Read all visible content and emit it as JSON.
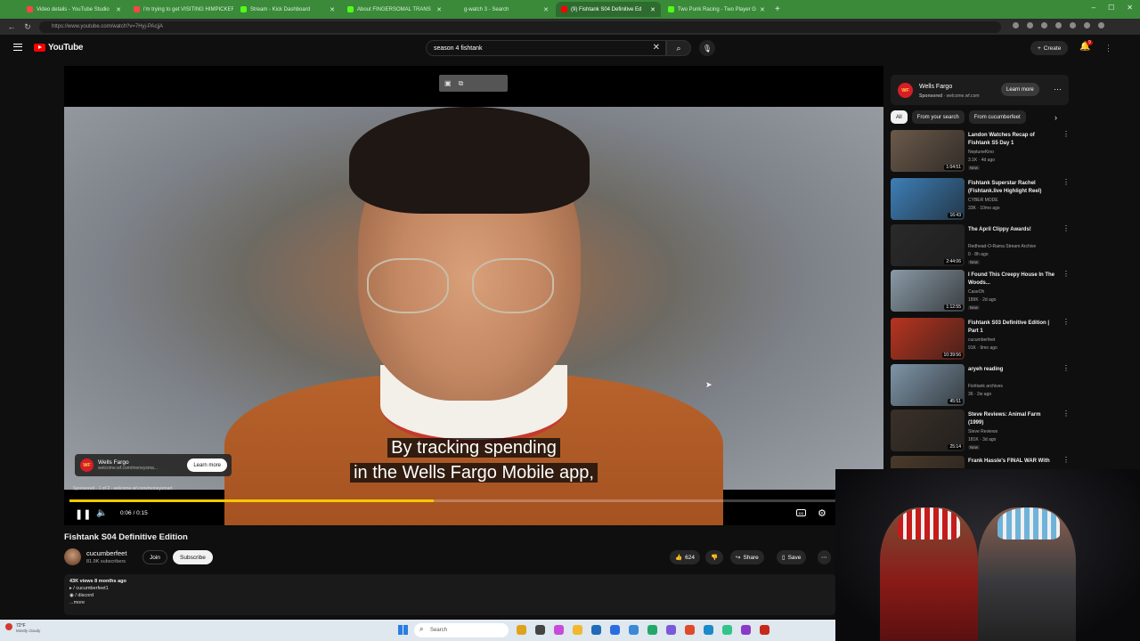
{
  "browser": {
    "tabs": [
      {
        "title": "Video details - YouTube Studio",
        "active": false,
        "icon_color": "#ff4444"
      },
      {
        "title": "i'm trying to get VISITING HIMPICKERS",
        "active": false,
        "icon_color": "#ff4444"
      },
      {
        "title": "Stream - Kick Dashboard",
        "active": false,
        "icon_color": "#53fc18"
      },
      {
        "title": "About FINGERSOMAL TRANS",
        "active": false,
        "icon_color": "#53fc18"
      },
      {
        "title": "g-watch 3 - Search",
        "active": false,
        "icon_color": "#3a8a3a"
      },
      {
        "title": "(9) Fishtank S04 Definitive Ed",
        "active": true,
        "icon_color": "#ff0000"
      },
      {
        "title": "Two Punk Racing - Two Player G",
        "active": false,
        "icon_color": "#53fc18"
      }
    ],
    "new_tab": "+",
    "url": "https://www.youtube.com/watch?v=7Hyj-PAcjjA"
  },
  "header": {
    "logo_text": "YouTube",
    "search_value": "season 4 fishtank",
    "clear_icon": "✕",
    "search_icon": "⌕",
    "mic_icon": "🎙",
    "create_label": "Create",
    "notif_count": "9"
  },
  "player": {
    "subtitle_line1": "By tracking spending",
    "subtitle_line2": "in the Wells Fargo Mobile app,",
    "ad_title": "Wells Fargo",
    "ad_url": "welcome.wf.com/moneysma...",
    "ad_learn": "Learn more",
    "sponsored_line": "Sponsored · 1 of 2 · welcome.wf.com/moneysmart",
    "time": "0:06 / 0:15",
    "progress": 0.45,
    "progress_color": "#f6c800",
    "cc_label": "CC",
    "badge_text": "WF"
  },
  "video": {
    "title": "Fishtank S04 Definitive Edition",
    "channel": "cucumberfeet",
    "subscribers": "81.9K subscribers",
    "join": "Join",
    "subscribe": "Subscribe",
    "likes": "624",
    "share": "Share",
    "save": "Save"
  },
  "description": {
    "meta": "43K views  8 months ago",
    "line1": "/ cucumberfeet1",
    "line2": "/ discord",
    "more": "...more"
  },
  "sidebar": {
    "ad_title": "Wells Fargo",
    "ad_sponsored": "Sponsored",
    "ad_url": "welcome.wf.com",
    "ad_learn": "Learn more",
    "chips": [
      "All",
      "From your search",
      "From cucumberfeet"
    ],
    "recs": [
      {
        "title": "Landon Watches Recap of Fishtank S5 Day 1",
        "channel": "NeptuneKino",
        "meta": "3.1K · 4d ago",
        "badge": "New",
        "duration": "1:04:51",
        "thumb": "#6b5a4a"
      },
      {
        "title": "Fishtank Superstar Rachel (Fishtank.live Highlight Reel)",
        "channel": "CYBER MODE",
        "meta": "33K · 10mo ago",
        "badge": "",
        "duration": "16:43",
        "thumb": "#3d7fb8"
      },
      {
        "title": "The April Clippy Awards!",
        "channel": "Redhead-O-Rama Stream Archive",
        "meta": "0 · 8h ago",
        "badge": "New",
        "duration": "2:44:06",
        "thumb": "#2a2a2a"
      },
      {
        "title": "I Found This Creepy House In The Woods...",
        "channel": "CaseOh",
        "meta": "189K · 2d ago",
        "badge": "New",
        "duration": "1:12:55",
        "thumb": "#8a9aa6"
      },
      {
        "title": "Fishtank S03 Definitive Edition | Part 1",
        "channel": "cucumberfeet",
        "meta": "91K · 9mo ago",
        "badge": "",
        "duration": "10:39:56",
        "thumb": "#b8341f"
      },
      {
        "title": "aryeh reading",
        "channel": "Fishtank archives",
        "meta": "36 · 2w ago",
        "badge": "",
        "duration": "45:51",
        "thumb": "#7e95a8"
      },
      {
        "title": "Steve Reviews: Animal Farm (1999)",
        "channel": "Steve Reviews",
        "meta": "181K · 3d ago",
        "badge": "New",
        "duration": "25:14",
        "thumb": "#3a3028"
      },
      {
        "title": "Frank Hassle's FINAL WAR With",
        "channel": "",
        "meta": "",
        "badge": "",
        "duration": "",
        "thumb": "#4a3a2a"
      }
    ]
  },
  "taskbar": {
    "weather_temp": "72°F",
    "weather_desc": "Mostly cloudy",
    "search_placeholder": "Search"
  }
}
